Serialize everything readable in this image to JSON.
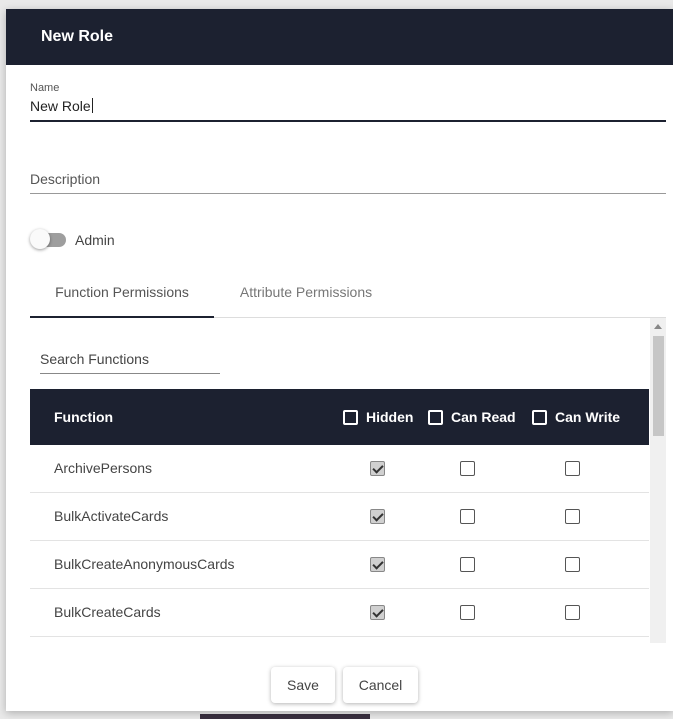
{
  "dialog": {
    "title": "New Role",
    "name_label": "Name",
    "name_value": "New Role",
    "description_placeholder": "Description",
    "admin_label": "Admin",
    "admin_enabled": false
  },
  "tabs": [
    {
      "label": "Function Permissions",
      "active": true
    },
    {
      "label": "Attribute Permissions",
      "active": false
    }
  ],
  "search": {
    "placeholder": "Search Functions"
  },
  "table": {
    "headers": {
      "function": "Function",
      "hidden": "Hidden",
      "can_read": "Can Read",
      "can_write": "Can Write"
    },
    "rows": [
      {
        "name": "ArchivePersons",
        "hidden": true,
        "can_read": false,
        "can_write": false
      },
      {
        "name": "BulkActivateCards",
        "hidden": true,
        "can_read": false,
        "can_write": false
      },
      {
        "name": "BulkCreateAnonymousCards",
        "hidden": true,
        "can_read": false,
        "can_write": false
      },
      {
        "name": "BulkCreateCards",
        "hidden": true,
        "can_read": false,
        "can_write": false
      }
    ]
  },
  "actions": {
    "save": "Save",
    "cancel": "Cancel"
  },
  "colors": {
    "header_bg": "#1c2130",
    "accent": "#1c2130"
  }
}
